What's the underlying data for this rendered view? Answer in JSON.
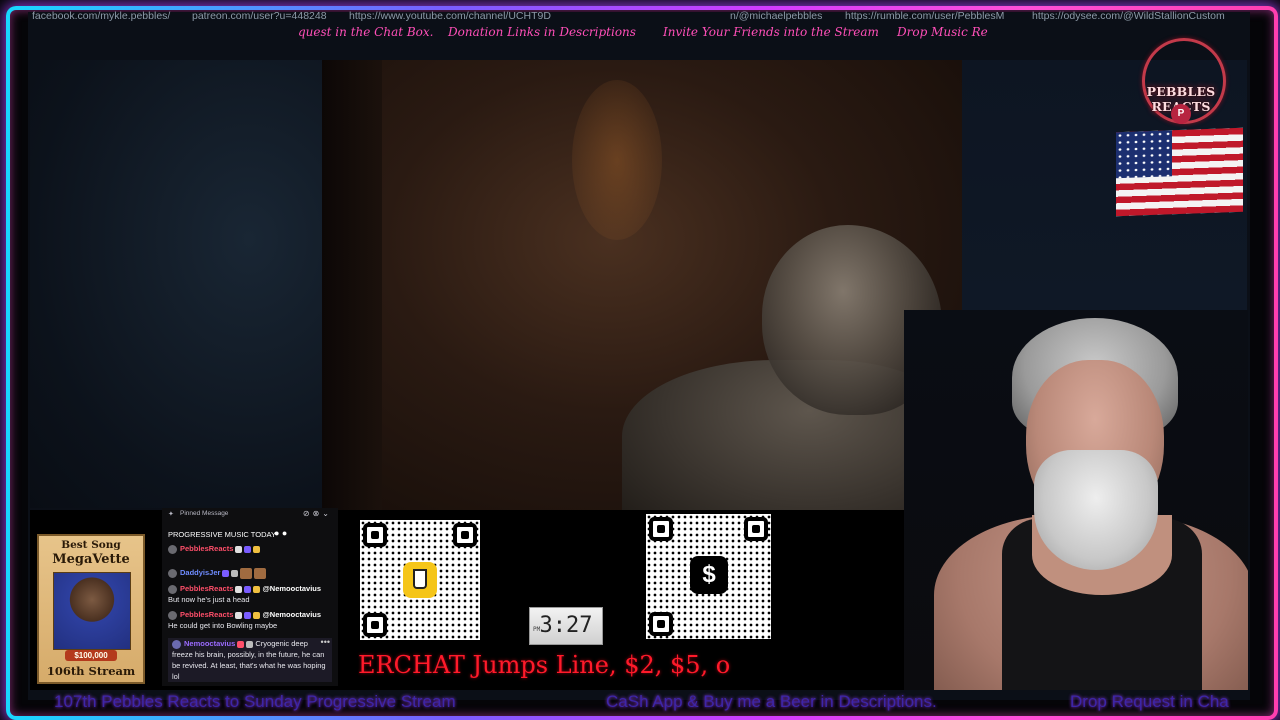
{
  "top_links": [
    "facebook.com/mykle.pebbles/",
    "patreon.com/user?u=448248",
    "https://www.youtube.com/channel/UCHT9D",
    "n/@michaelpebbles",
    "https://rumble.com/user/PebblesM",
    "https://odysee.com/@WildStallionCustom"
  ],
  "ticker_top": [
    "quest in the Chat Box.",
    "Donation Links in Descriptions",
    "Invite Your Friends into the Stream",
    "Drop Music Re"
  ],
  "logo": {
    "text": "PEBBLES REACTS",
    "letter": "P"
  },
  "badge": {
    "line1": "Best Song",
    "line2": "MegaVette",
    "money": "$100,000",
    "line3": "106th Stream"
  },
  "chat": {
    "pinned_header": "Pinned Message",
    "pinned_text": "PROGRESSIVE MUSIC TODAY",
    "pinned_user": "PebblesReacts",
    "messages": [
      {
        "user": "DaddyisJer",
        "text": ""
      },
      {
        "user": "PebblesReacts",
        "mention": "@Nemooctavius",
        "text": "But now he's just a head"
      },
      {
        "user": "PebblesReacts",
        "mention": "@Nemooctavius",
        "text": "He could get into Bowling maybe"
      },
      {
        "user": "Nemooctavius",
        "text": "Cryogenic deep freeze his brain, possibly, in the future, he can be revived. At least, that's what he was hoping lol"
      }
    ]
  },
  "qr_left_icon": "beer-cup-icon",
  "qr_right_icon": "dollar-icon",
  "qr_right_symbol": "$",
  "clock": {
    "ampm": "PM",
    "time": "3:27"
  },
  "ticker_mid": "ERCHAT Jumps Line, $2, $5, o",
  "ticker_bottom": [
    "107th Pebbles Reacts to Sunday Progressive Stream",
    "CaSh App & Buy me a Beer in Descriptions.",
    "Drop Request in Cha"
  ],
  "colors": {
    "ticker_pink": "#ff4fb8",
    "ticker_red": "#ff1a2a",
    "ticker_bottom": "#3d26a8"
  }
}
